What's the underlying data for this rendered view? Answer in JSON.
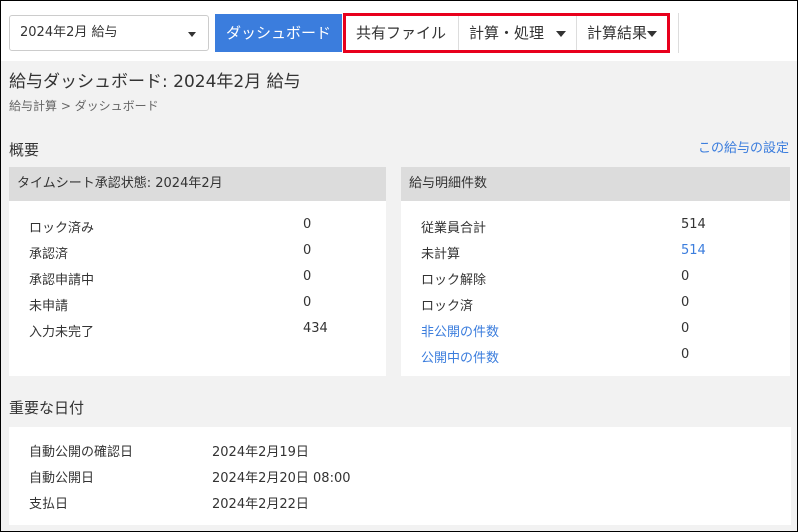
{
  "toolbar": {
    "payroll_select": "2024年2月 給与",
    "tabs": [
      {
        "label": "ダッシュボード"
      },
      {
        "label": "共有ファイル"
      },
      {
        "label": "計算・処理"
      },
      {
        "label": "計算結果"
      }
    ]
  },
  "page": {
    "title": "給与ダッシュボード: 2024年2月 給与",
    "breadcrumb": "給与計算 > ダッシュボード"
  },
  "overview": {
    "title": "概要",
    "settings_link": "この給与の設定",
    "timesheet": {
      "title": "タイムシート承認状態: 2024年2月",
      "rows": [
        {
          "label": "ロック済み",
          "value": "0"
        },
        {
          "label": "承認済",
          "value": "0"
        },
        {
          "label": "承認申請中",
          "value": "0"
        },
        {
          "label": "未申請",
          "value": "0"
        },
        {
          "label": "入力未完了",
          "value": "434"
        }
      ]
    },
    "payslips": {
      "title": "給与明細件数",
      "rows": [
        {
          "label": "従業員合計",
          "value": "514"
        },
        {
          "label": "未計算",
          "value": "514"
        },
        {
          "label": "ロック解除",
          "value": "0"
        },
        {
          "label": "ロック済",
          "value": "0"
        },
        {
          "label": "非公開の件数",
          "value": "0"
        },
        {
          "label": "公開中の件数",
          "value": "0"
        }
      ]
    }
  },
  "dates": {
    "title": "重要な日付",
    "rows": [
      {
        "label": "自動公開の確認日",
        "value": "2024年2月19日"
      },
      {
        "label": "自動公開日",
        "value": "2024年2月20日 08:00"
      },
      {
        "label": "支払日",
        "value": "2024年2月22日"
      }
    ]
  },
  "colors": {
    "accent": "#3b7ddd",
    "highlight_border": "#e8001c",
    "panel_header": "#dcdcdc"
  }
}
